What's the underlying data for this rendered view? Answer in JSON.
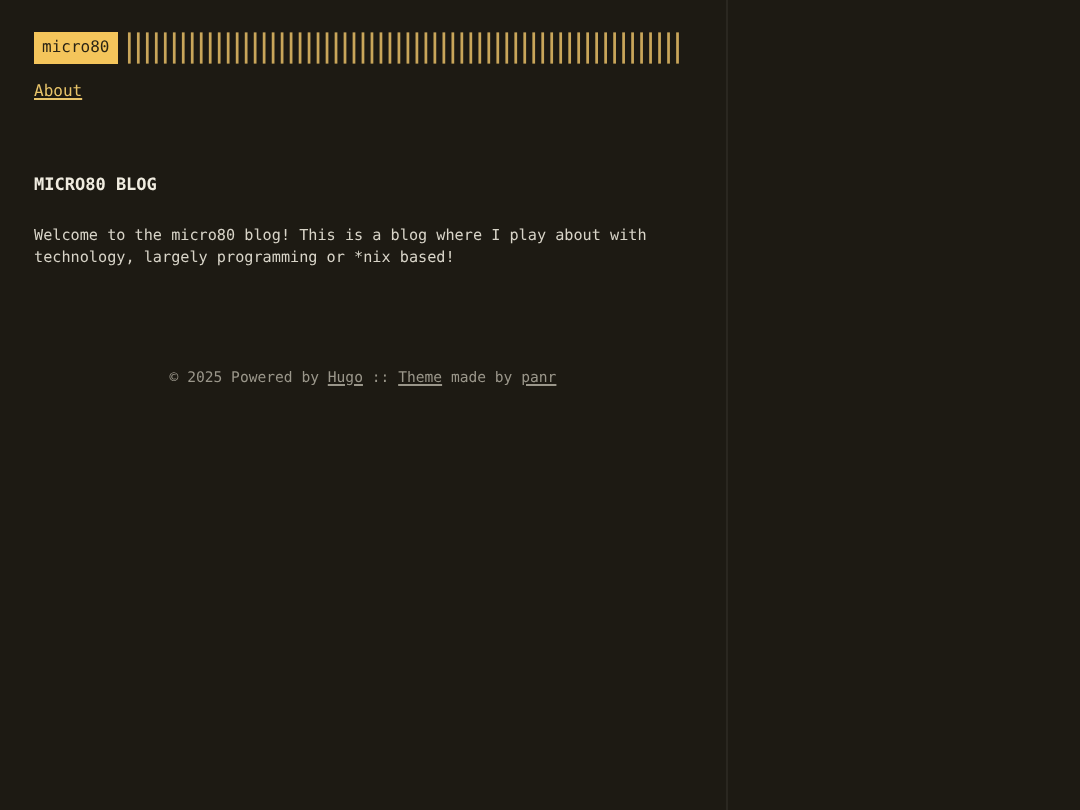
{
  "logo": {
    "text": "micro80"
  },
  "nav": [
    {
      "label": "About"
    }
  ],
  "post": {
    "title": "MICRO80 BLOG",
    "body": "Welcome to the micro80 blog! This is a blog where I play about with technology, largely programming or *nix based!"
  },
  "footer": [
    {
      "kind": "text",
      "text": "© 2025 Powered by"
    },
    {
      "kind": "link",
      "text": "Hugo"
    },
    {
      "kind": "text",
      "text": "::"
    },
    {
      "kind": "link",
      "text": "Theme"
    },
    {
      "kind": "text",
      "text": "made by"
    },
    {
      "kind": "link",
      "text": "panr"
    }
  ]
}
